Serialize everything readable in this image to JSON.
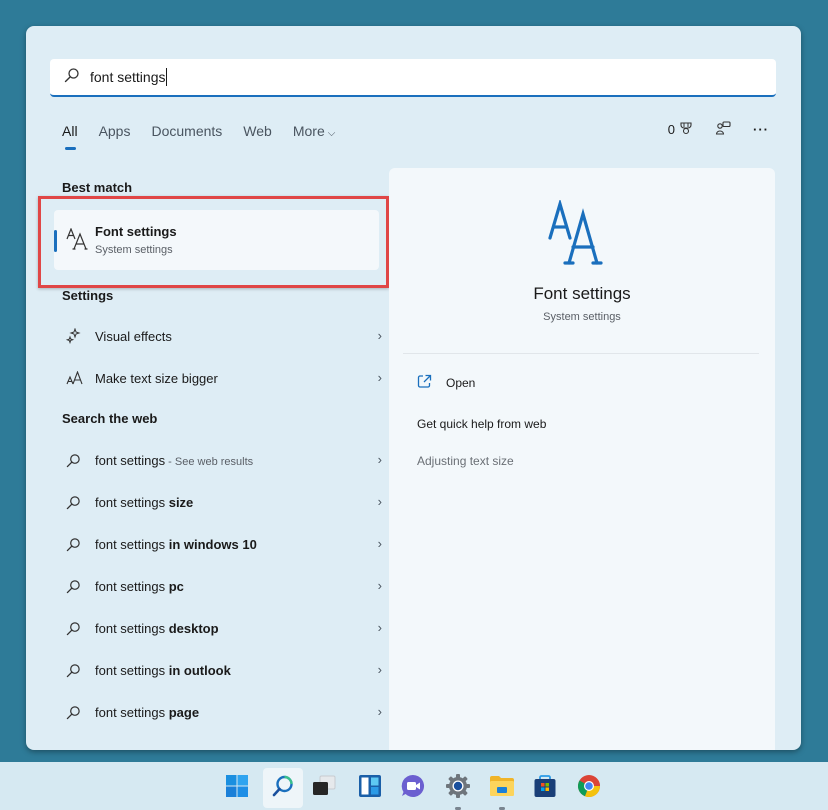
{
  "search": {
    "value": "font settings",
    "icon": "search-icon"
  },
  "tabs": [
    {
      "label": "All",
      "active": true
    },
    {
      "label": "Apps",
      "active": false
    },
    {
      "label": "Documents",
      "active": false
    },
    {
      "label": "Web",
      "active": false
    },
    {
      "label": "More",
      "active": false
    }
  ],
  "toolbar": {
    "points": "0",
    "points_icon": "trophy-icon",
    "feedback_icon": "people-chat-icon",
    "more_icon": "ellipsis-icon",
    "more_label": "···"
  },
  "best_match": {
    "heading": "Best match",
    "title": "Font settings",
    "subtitle": "System settings",
    "icon": "font-aa-icon"
  },
  "settings": {
    "heading": "Settings",
    "items": [
      {
        "label": "Visual effects",
        "icon": "sparkle-icon"
      },
      {
        "label": "Make text size bigger",
        "icon": "text-size-icon"
      }
    ]
  },
  "web": {
    "heading": "Search the web",
    "items": [
      {
        "prefix": "font settings",
        "suffix": "",
        "hint": " - See web results"
      },
      {
        "prefix": "font settings ",
        "suffix": "size",
        "hint": ""
      },
      {
        "prefix": "font settings ",
        "suffix": "in windows 10",
        "hint": ""
      },
      {
        "prefix": "font settings ",
        "suffix": "pc",
        "hint": ""
      },
      {
        "prefix": "font settings ",
        "suffix": "desktop",
        "hint": ""
      },
      {
        "prefix": "font settings ",
        "suffix": "in outlook",
        "hint": ""
      },
      {
        "prefix": "font settings ",
        "suffix": "page",
        "hint": ""
      }
    ]
  },
  "preview": {
    "title": "Font settings",
    "subtitle": "System settings",
    "actions": {
      "open": "Open",
      "help": "Get quick help from web",
      "adjust": "Adjusting text size"
    }
  },
  "chevron": "›",
  "taskbar": {
    "icons": [
      {
        "name": "start-icon",
        "active": false,
        "running": false
      },
      {
        "name": "search-icon",
        "active": true,
        "running": false
      },
      {
        "name": "task-view-icon",
        "active": false,
        "running": false
      },
      {
        "name": "widgets-icon",
        "active": false,
        "running": false
      },
      {
        "name": "teams-chat-icon",
        "active": false,
        "running": false
      },
      {
        "name": "settings-gear-icon",
        "active": false,
        "running": true
      },
      {
        "name": "file-explorer-icon",
        "active": false,
        "running": true
      },
      {
        "name": "store-icon",
        "active": false,
        "running": false
      },
      {
        "name": "chrome-icon",
        "active": false,
        "running": false
      }
    ]
  },
  "colors": {
    "accent": "#1a6fbd",
    "highlight": "#e04646",
    "desktop": "#2e7b98"
  }
}
